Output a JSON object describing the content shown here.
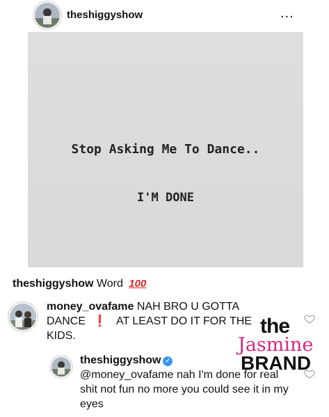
{
  "post": {
    "username": "theshiggyshow",
    "more_label": "...",
    "image_line1": "Stop Asking Me To Dance..",
    "image_line2": "I'M DONE"
  },
  "caption": {
    "username": "theshiggyshow",
    "text": "Word",
    "emoji": "100"
  },
  "comments": [
    {
      "username": "money_ovafame",
      "text_before": "NAH BRO U GOTTA DANCE",
      "exclamation": "❗",
      "text_after": "AT LEAST DO IT FOR THE KIDS."
    },
    {
      "username": "theshiggyshow",
      "mention": "@money_ovafame",
      "text": "nah I'm done for real shit not fun no more you could see it in my eyes"
    }
  ],
  "watermark": {
    "line1": "the",
    "line2": "Jasmine",
    "line3": "BRAND"
  },
  "colors": {
    "accent_red": "#e0231e",
    "verified_blue": "#3897f0",
    "watermark_pink": "#d4287c"
  }
}
